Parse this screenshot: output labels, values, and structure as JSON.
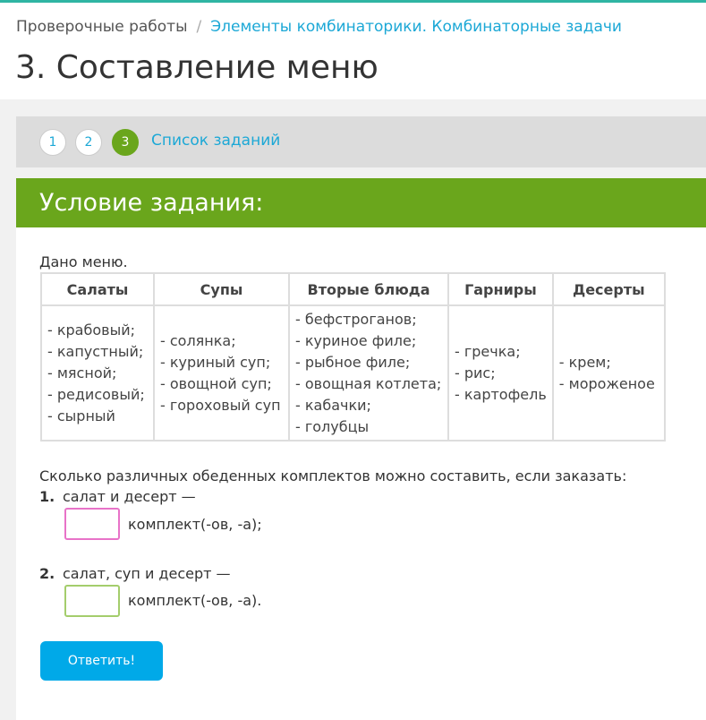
{
  "breadcrumb": {
    "root": "Проверочные работы",
    "separator": "/",
    "current": "Элементы комбинаторики. Комбинаторные задачи"
  },
  "page_title": "3. Составление меню",
  "stepper": {
    "steps": [
      "1",
      "2",
      "3"
    ],
    "active_step": "3",
    "task_list_label": "Список заданий"
  },
  "card": {
    "title": "Условие задания:",
    "intro": "Дано меню.",
    "table": {
      "headers": [
        "Салаты",
        "Супы",
        "Вторые блюда",
        "Гарниры",
        "Десерты"
      ],
      "columns": [
        [
          "- крабовый;",
          "- капустный;",
          "- мясной;",
          "- редисовый;",
          "- сырный"
        ],
        [
          "- солянка;",
          "- куриный суп;",
          "- овощной суп;",
          "- гороховый суп"
        ],
        [
          "- бефстроганов;",
          "- куриное филе;",
          "- рыбное филе;",
          "- овощная котлета;",
          "- кабачки;",
          "- голубцы"
        ],
        [
          "- гречка;",
          "- рис;",
          "- картофель"
        ],
        [
          "- крем;",
          "- мороженое"
        ]
      ]
    },
    "question": "Сколько различных обеденных комплектов можно составить, если заказать:",
    "items": [
      {
        "number": "1.",
        "text": "салат и десерт —",
        "value": "",
        "unit": "комплект(-ов, -а);"
      },
      {
        "number": "2.",
        "text": "салат, суп и десерт —",
        "value": "",
        "unit": "комплект(-ов, -а)."
      }
    ],
    "submit_label": "Ответить!"
  },
  "colors": {
    "accent_green": "#6aa61c",
    "link_blue": "#1ca8d6",
    "button_blue": "#00a9e8",
    "input1_border": "#e873c8",
    "input2_border": "#a4cd6c",
    "top_line": "#2fb5a3"
  }
}
